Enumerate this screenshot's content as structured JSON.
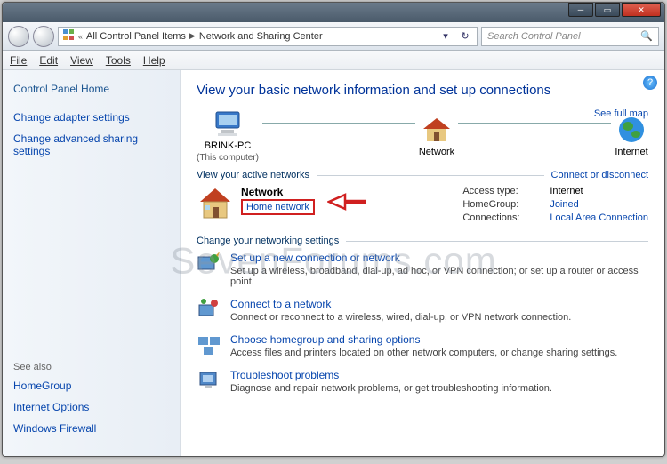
{
  "breadcrumb": {
    "back": "«",
    "item1": "All Control Panel Items",
    "item2": "Network and Sharing Center"
  },
  "search": {
    "placeholder": "Search Control Panel"
  },
  "menu": {
    "file": "File",
    "edit": "Edit",
    "view": "View",
    "tools": "Tools",
    "help": "Help"
  },
  "sidebar": {
    "home": "Control Panel Home",
    "adapter": "Change adapter settings",
    "advanced": "Change advanced sharing settings",
    "seealso": "See also",
    "homegroup": "HomeGroup",
    "inet": "Internet Options",
    "firewall": "Windows Firewall"
  },
  "page": {
    "title": "View your basic network information and set up connections",
    "fullmap": "See full map",
    "thispc": "BRINK-PC",
    "thispc_sub": "(This computer)",
    "network": "Network",
    "internet": "Internet",
    "viewactive": "View your active networks",
    "connect": "Connect or disconnect",
    "net_name": "Network",
    "net_type": "Home network",
    "access_lbl": "Access type:",
    "access_val": "Internet",
    "hg_lbl": "HomeGroup:",
    "hg_val": "Joined",
    "conn_lbl": "Connections:",
    "conn_val": "Local Area Connection",
    "changeset": "Change your networking settings"
  },
  "settings": [
    {
      "title": "Set up a new connection or network",
      "sub": "Set up a wireless, broadband, dial-up, ad hoc, or VPN connection; or set up a router or access point."
    },
    {
      "title": "Connect to a network",
      "sub": "Connect or reconnect to a wireless, wired, dial-up, or VPN network connection."
    },
    {
      "title": "Choose homegroup and sharing options",
      "sub": "Access files and printers located on other network computers, or change sharing settings."
    },
    {
      "title": "Troubleshoot problems",
      "sub": "Diagnose and repair network problems, or get troubleshooting information."
    }
  ],
  "watermark": "SevenForums.com"
}
